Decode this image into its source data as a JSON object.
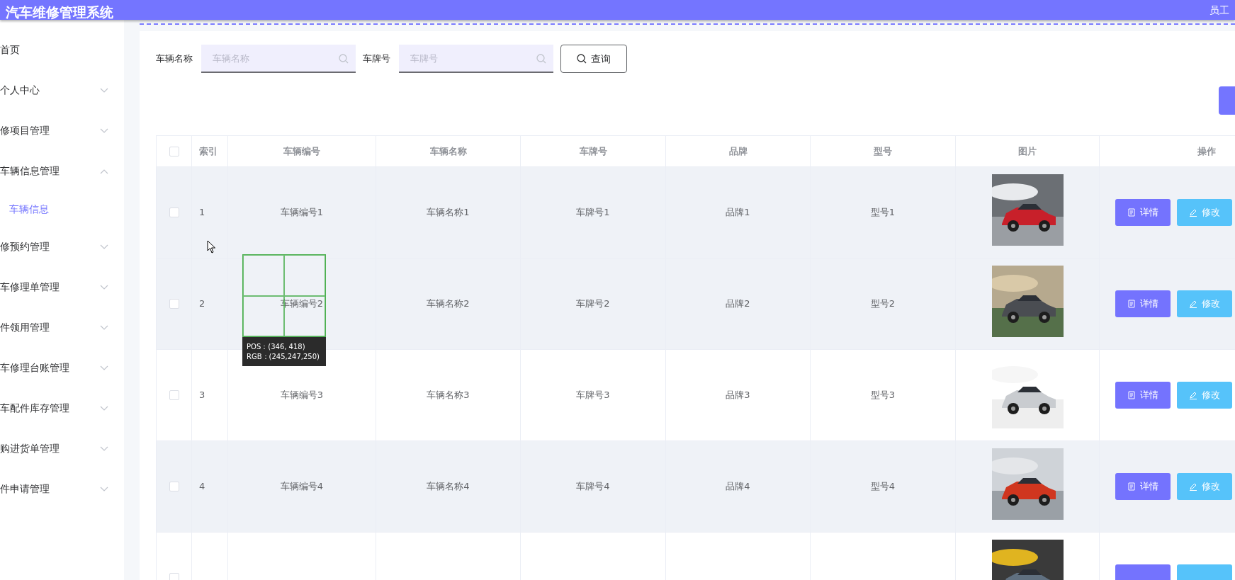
{
  "header": {
    "title": "汽车维修管理系统",
    "user": "员工"
  },
  "sidebar": {
    "items": [
      {
        "label": "首页"
      },
      {
        "label": "个人中心",
        "expanded": false
      },
      {
        "label": "修项目管理",
        "expanded": false
      },
      {
        "label": "车辆信息管理",
        "expanded": true,
        "children": [
          {
            "label": "车辆信息",
            "selected": true
          }
        ]
      },
      {
        "label": "修预约管理",
        "expanded": false
      },
      {
        "label": "车修理单管理",
        "expanded": false
      },
      {
        "label": "件领用管理",
        "expanded": false
      },
      {
        "label": "车修理台账管理",
        "expanded": false
      },
      {
        "label": "车配件库存管理",
        "expanded": false
      },
      {
        "label": "购进货单管理",
        "expanded": false
      },
      {
        "label": "件申请管理",
        "expanded": false
      }
    ]
  },
  "search": {
    "fields": [
      {
        "label": "车辆名称",
        "placeholder": "车辆名称"
      },
      {
        "label": "车牌号",
        "placeholder": "车牌号"
      }
    ],
    "button": "查询"
  },
  "table": {
    "columns": [
      "索引",
      "车辆编号",
      "车辆名称",
      "车牌号",
      "品牌",
      "型号",
      "图片",
      "操作"
    ],
    "header_checked": false,
    "rows": [
      {
        "checked": false,
        "highlighted": true,
        "cells": [
          "1",
          "车辆编号1",
          "车辆名称1",
          "车牌号1",
          "品牌1",
          "型号1"
        ],
        "actions": [
          "详情",
          "修改"
        ]
      },
      {
        "checked": false,
        "highlighted": true,
        "cells": [
          "2",
          "车辆编号2",
          "车辆名称2",
          "车牌号2",
          "品牌2",
          "型号2"
        ],
        "actions": [
          "详情",
          "修改"
        ]
      },
      {
        "checked": false,
        "highlighted": false,
        "cells": [
          "3",
          "车辆编号3",
          "车辆名称3",
          "车牌号3",
          "品牌3",
          "型号3"
        ],
        "actions": [
          "详情",
          "修改"
        ]
      },
      {
        "checked": false,
        "highlighted": true,
        "cells": [
          "4",
          "车辆编号4",
          "车辆名称4",
          "车牌号4",
          "品牌4",
          "型号4"
        ],
        "actions": [
          "详情",
          "修改"
        ]
      },
      {
        "checked": false,
        "highlighted": false
      }
    ]
  },
  "color_picker": {
    "position": "POS：(346, 418)",
    "rgb": "RGB：(245,247,250)"
  }
}
